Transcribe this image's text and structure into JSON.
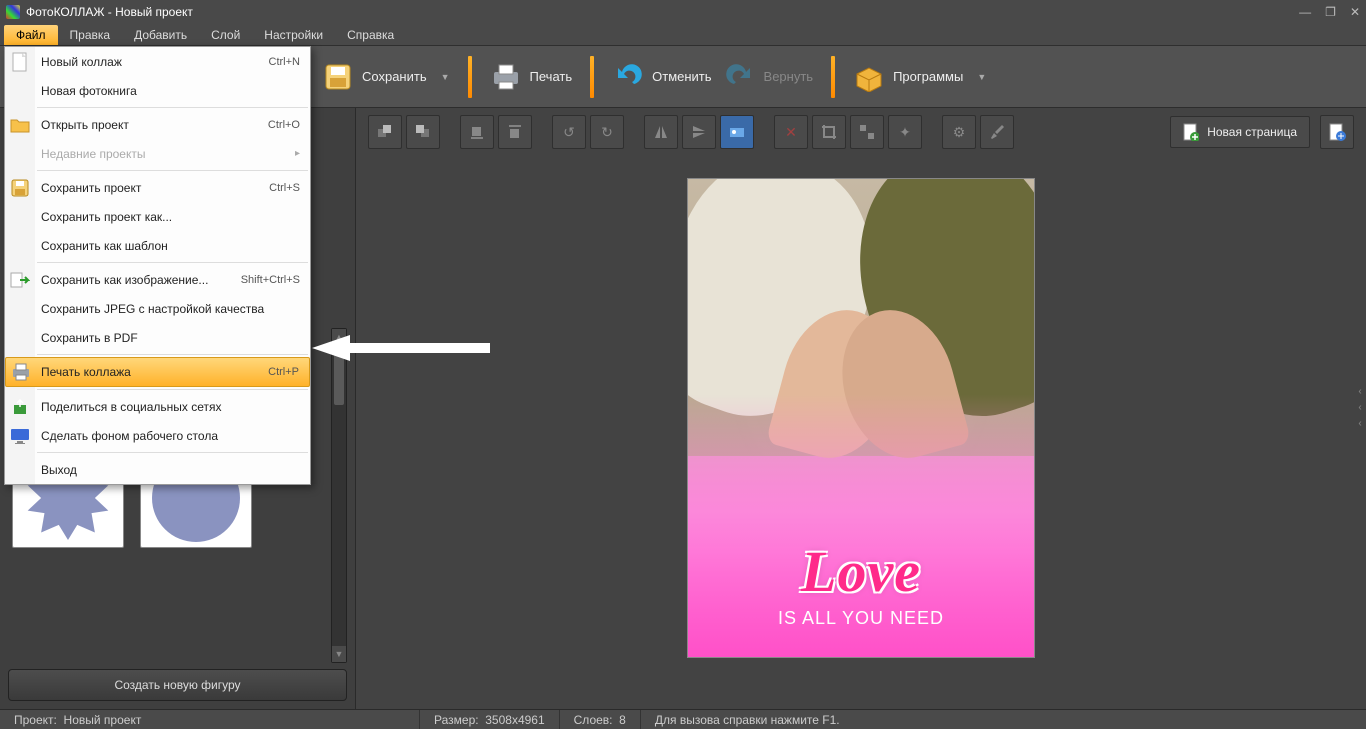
{
  "titlebar": {
    "title": "ФотоКОЛЛАЖ - Новый проект"
  },
  "menubar": {
    "items": [
      "Файл",
      "Правка",
      "Добавить",
      "Слой",
      "Настройки",
      "Справка"
    ],
    "active_index": 0
  },
  "bigbar": {
    "save": "Сохранить",
    "print": "Печать",
    "undo": "Отменить",
    "redo": "Вернуть",
    "programs": "Программы"
  },
  "edittools": {
    "newpage": "Новая страница"
  },
  "file_menu": {
    "items": [
      {
        "icon": "doc",
        "label": "Новый коллаж",
        "shortcut": "Ctrl+N"
      },
      {
        "icon": "",
        "label": "Новая фотокнига",
        "shortcut": ""
      },
      {
        "divider": true
      },
      {
        "icon": "folder",
        "label": "Открыть проект",
        "shortcut": "Ctrl+O"
      },
      {
        "icon": "",
        "label": "Недавние проекты",
        "shortcut": "",
        "disabled": true,
        "submenu": true
      },
      {
        "divider": true
      },
      {
        "icon": "disk",
        "label": "Сохранить проект",
        "shortcut": "Ctrl+S"
      },
      {
        "icon": "",
        "label": "Сохранить проект как...",
        "shortcut": ""
      },
      {
        "icon": "",
        "label": "Сохранить как шаблон",
        "shortcut": ""
      },
      {
        "divider": true
      },
      {
        "icon": "export",
        "label": "Сохранить как изображение...",
        "shortcut": "Shift+Ctrl+S"
      },
      {
        "icon": "",
        "label": "Сохранить JPEG с настройкой качества",
        "shortcut": ""
      },
      {
        "icon": "",
        "label": "Сохранить в PDF",
        "shortcut": ""
      },
      {
        "divider": true
      },
      {
        "icon": "printer",
        "label": "Печать коллажа",
        "shortcut": "Ctrl+P",
        "highlight": true
      },
      {
        "divider": true
      },
      {
        "icon": "share",
        "label": "Поделиться в социальных сетях",
        "shortcut": ""
      },
      {
        "icon": "desktop",
        "label": "Сделать фоном рабочего стола",
        "shortcut": ""
      },
      {
        "divider": true
      },
      {
        "icon": "",
        "label": "Выход",
        "shortcut": ""
      }
    ]
  },
  "sidepanel": {
    "create_button": "Создать новую фигуру"
  },
  "canvas": {
    "love_title": "Love",
    "love_sub": "IS ALL YOU NEED"
  },
  "statusbar": {
    "project_label": "Проект:",
    "project_value": "Новый проект",
    "size_label": "Размер:",
    "size_value": "3508x4961",
    "layers_label": "Слоев:",
    "layers_value": "8",
    "help": "Для вызова справки нажмите F1."
  }
}
